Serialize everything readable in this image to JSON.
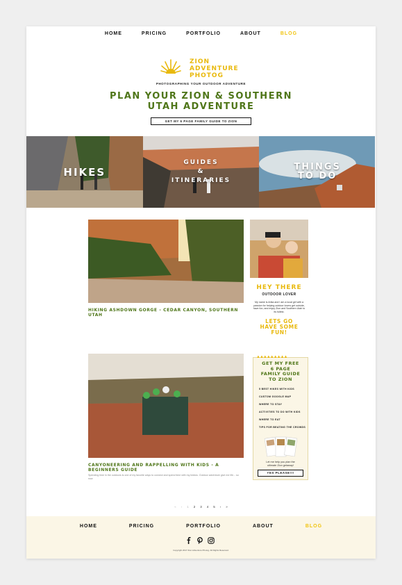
{
  "nav": {
    "items": [
      "HOME",
      "PRICING",
      "PORTFOLIO",
      "ABOUT",
      "BLOG"
    ],
    "active": "BLOG"
  },
  "logo": {
    "line1": "ZION",
    "line2": "ADVENTURE",
    "line3": "PHOTOG"
  },
  "tagline": "PHOTOGRAPHING YOUR OUTDOOR ADVENTURE",
  "headline": {
    "line1": "PLAN YOUR ZION & SOUTHERN",
    "line2": "UTAH ADVENTURE"
  },
  "cta_top": "GET MY 6 PAGE FAMILY GUIDE TO ZION",
  "tiles": [
    {
      "label": "HIKES"
    },
    {
      "line1": "GUIDES",
      "line2": "&",
      "line3": "ITINERARIES"
    },
    {
      "line1": "THINGS",
      "line2": "TO DO"
    }
  ],
  "posts": [
    {
      "title": "HIKING ASHDOWN GORGE - CEDAR CANYON, SOUTHERN UTAH"
    },
    {
      "title": "CANYONEERING AND RAPPELLING WITH KIDS - A BEGINNERS GUIDE",
      "excerpt": "Spending time in the outdoors is one of my favorite ways to connect and spend time with my kiddos. Outdoor adventure give me life... so now"
    }
  ],
  "sidebar": {
    "hey": "HEY THERE",
    "subtitle": "OUTDOOR LOVER",
    "bio": "My name is Arika and I am a local girl with a passion for helping outdoor lovers get outside, have fun, and enjoy Zion and Southern Utah to its fullest.",
    "lets_go": {
      "line1": "LETS GO",
      "line2": "HAVE SOME",
      "line3": "FUN!"
    }
  },
  "guide": {
    "title": {
      "line1": "GET MY FREE",
      "line2": "6 PAGE",
      "line3": "FAMILY GUIDE",
      "line4": "TO ZION"
    },
    "items": [
      "5 BEST HIKES WITH KIDS",
      "CUSTOM GOOGLE MAP",
      "WHERE TO STAY",
      "ACTIVITIES TO DO WITH KIDS",
      "WHERE TO EAT",
      "TIPS FOR BEATING THE CROWDS"
    ],
    "help": {
      "line1": "Let me help you plan the",
      "line2": "ultimate Zion getaway!"
    },
    "button": "YES PLEASE!!!"
  },
  "pager": [
    "«",
    "‹",
    "1",
    "2",
    "3",
    "4",
    "5",
    "›",
    "»"
  ],
  "footer": {
    "nav": [
      "HOME",
      "PRICING",
      "PORTFOLIO",
      "ABOUT",
      "BLOG"
    ],
    "active": "BLOG",
    "social": [
      "facebook-icon",
      "pinterest-icon",
      "instagram-icon"
    ],
    "copyright": "Copyright 2017 Zion Adventure Photog. All Rights Reserved."
  },
  "colors": {
    "green": "#4f7619",
    "yellow": "#e9b90d",
    "nav_active": "#f1c40f",
    "cream": "#fbf6e6"
  }
}
